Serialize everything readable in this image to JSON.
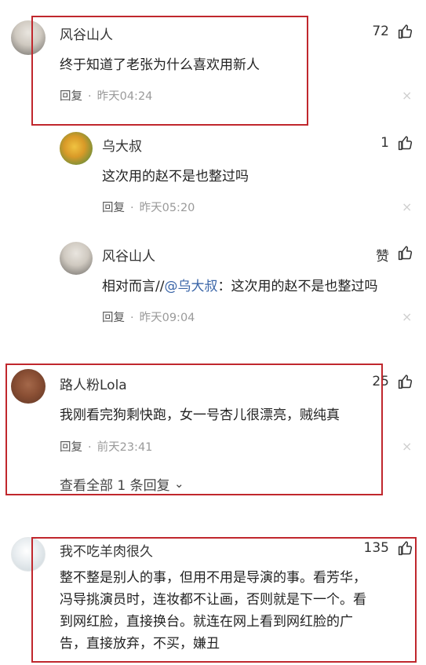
{
  "comments": [
    {
      "name": "风谷山人",
      "text": "终于知道了老张为什么喜欢用新人",
      "reply_label": "回复",
      "time": "昨天04:24",
      "likes": "72",
      "replies": [
        {
          "name": "乌大叔",
          "text": "这次用的赵不是也整过吗",
          "reply_label": "回复",
          "time": "昨天05:20",
          "likes": "1"
        },
        {
          "name": "风谷山人",
          "text_prefix": "相对而言//",
          "mention": "@乌大叔",
          "text_suffix": "：这次用的赵不是也整过吗",
          "reply_label": "回复",
          "time": "昨天09:04",
          "likes": "赞"
        }
      ]
    },
    {
      "name": "路人粉Lola",
      "text": "我刚看完狗剩快跑，女一号杏儿很漂亮，贼纯真",
      "reply_label": "回复",
      "time": "前天23:41",
      "likes": "25",
      "view_all": "查看全部 1 条回复"
    },
    {
      "name": "我不吃羊肉很久",
      "text_lines": [
        "整不整是别人的事，但用不用是导演的事。看芳华，",
        "冯导挑演员时，连妆都不让画，否则就是下一个。看",
        "到网红脸，直接换台。就连在网上看到网红脸的广",
        "告，直接放弃，不买，嫌丑"
      ],
      "likes": "135"
    }
  ],
  "ui": {
    "dot": "·",
    "close": "×",
    "chevron": "⌄"
  },
  "colors": {
    "highlight_frame": "#c0272d",
    "mention": "#3b66a8",
    "meta": "#9a9a9a"
  }
}
